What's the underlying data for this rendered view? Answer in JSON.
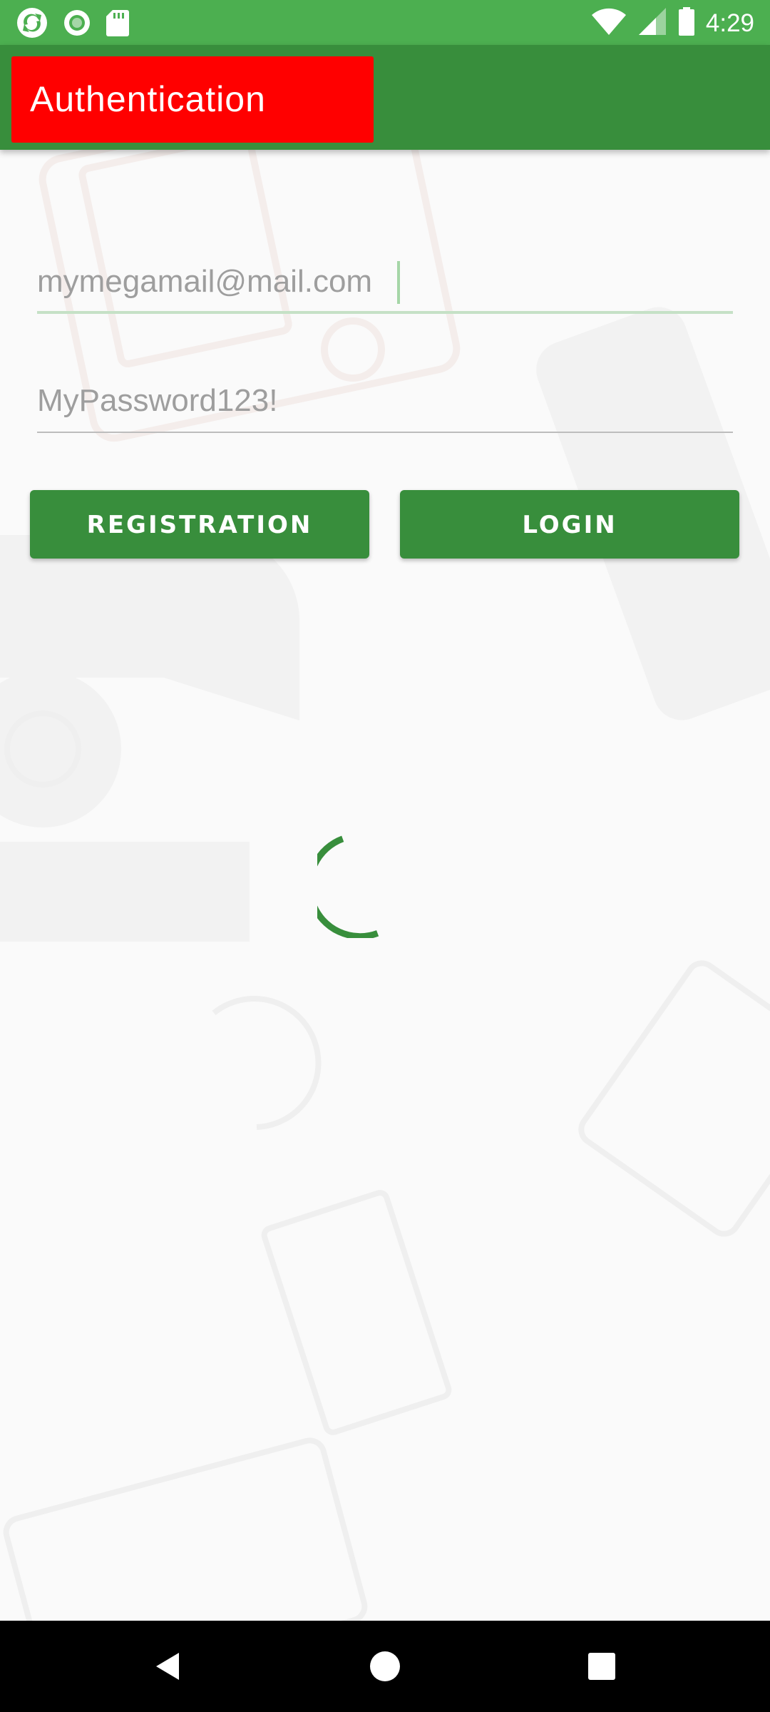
{
  "status_bar": {
    "time": "4:29",
    "left_icons": [
      "sync-app-icon",
      "circle-app-icon",
      "sd-card-icon"
    ],
    "right_icons": [
      "wifi-icon",
      "cell-signal-icon",
      "battery-icon"
    ]
  },
  "app_bar": {
    "title": "Authentication",
    "background": "#388e3c",
    "title_background": "#ff0000"
  },
  "form": {
    "email_placeholder": "mymegamail@mail.com",
    "email_value": "",
    "password_placeholder": "MyPassword123!",
    "password_value": ""
  },
  "buttons": {
    "registration_label": "REGISTRATION",
    "login_label": "LOGIN"
  },
  "loading": {
    "spinner_color": "#388e3c",
    "visible": true
  },
  "nav_bar": {
    "icons": [
      "back-icon",
      "home-icon",
      "recents-icon"
    ]
  },
  "colors": {
    "primary": "#388e3c",
    "status_bar": "#4caf50",
    "accent": "#ff0000"
  }
}
